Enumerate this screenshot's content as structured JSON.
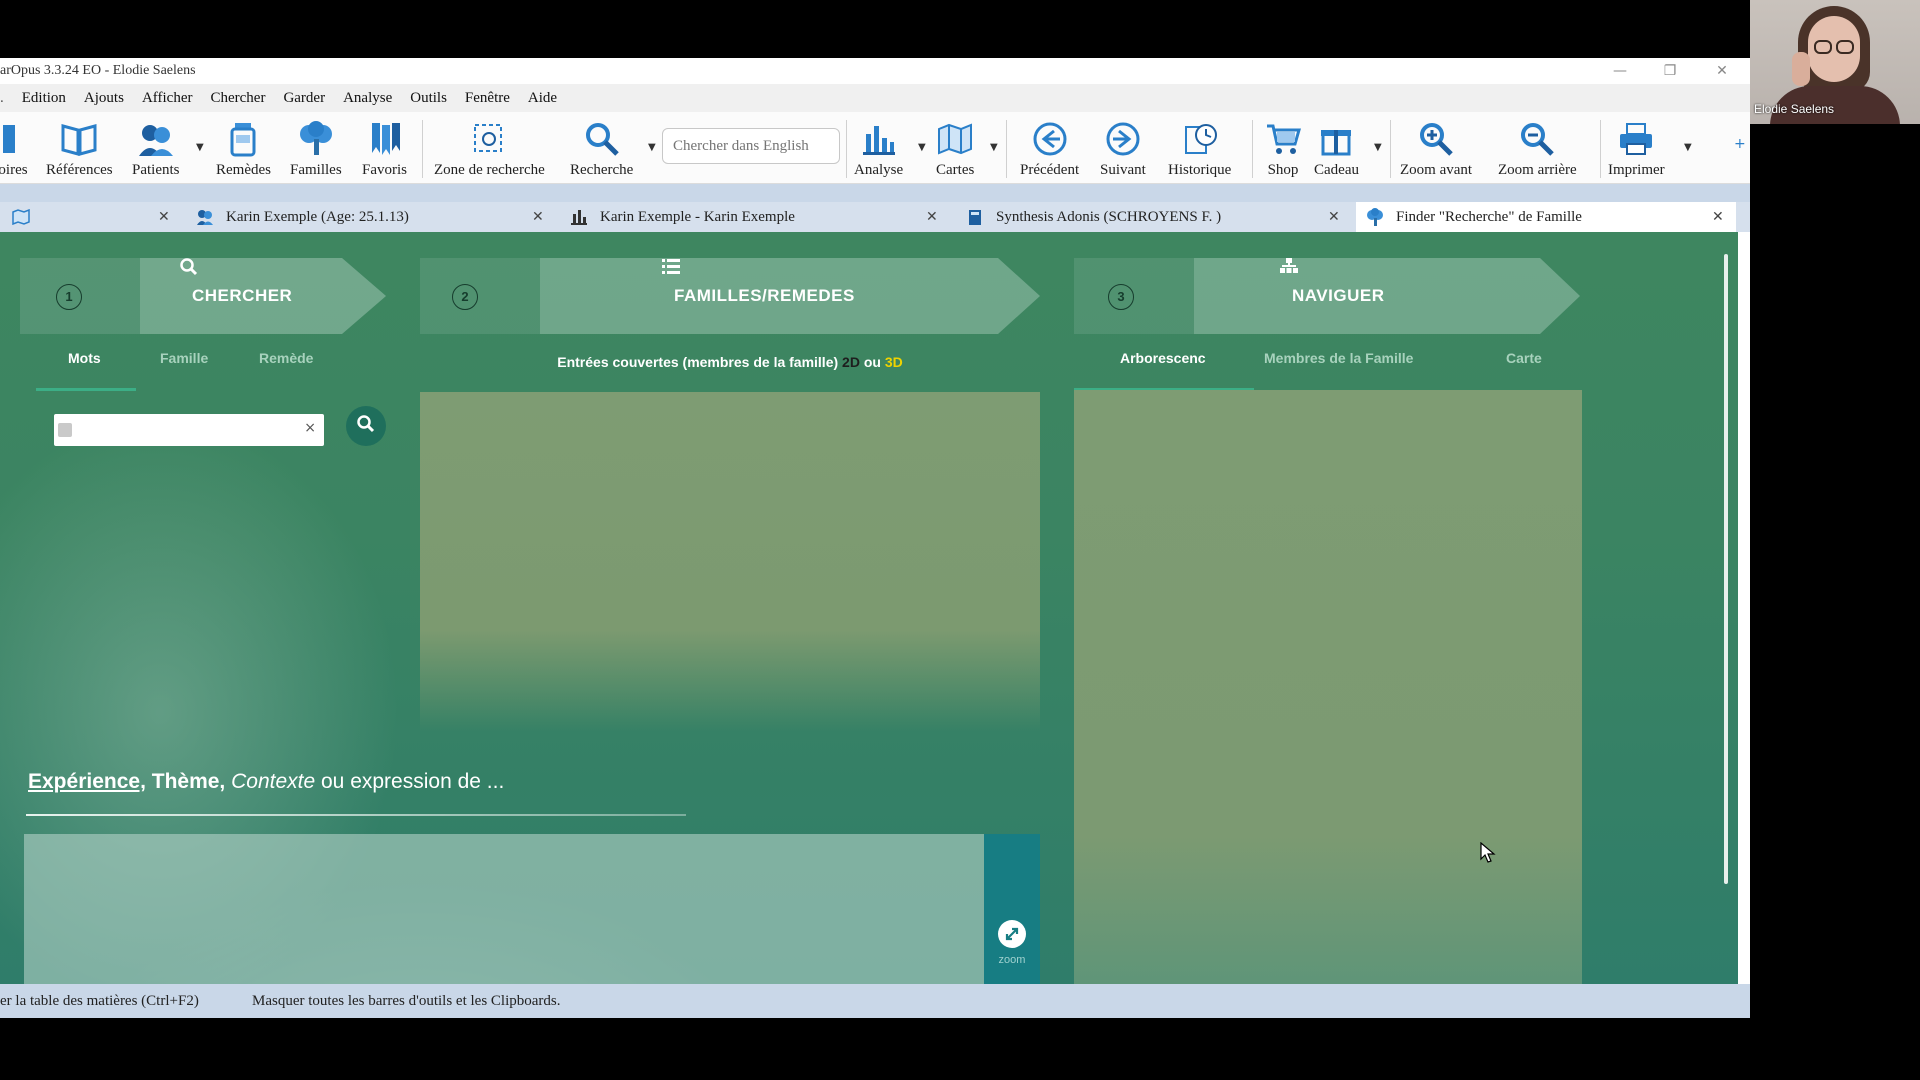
{
  "window": {
    "title": "arOpus 3.3.24  EO - Elodie Saelens"
  },
  "menu": [
    "Edition",
    "Ajouts",
    "Afficher",
    "Chercher",
    "Garder",
    "Analyse",
    "Outils",
    "Fenêtre",
    "Aide"
  ],
  "toolbar": {
    "items": [
      {
        "label": "oires",
        "icon": "book-icon"
      },
      {
        "label": "Références",
        "icon": "open-book-icon"
      },
      {
        "label": "Patients",
        "icon": "patients-icon"
      },
      {
        "label": "Remèdes",
        "icon": "remedy-jar-icon"
      },
      {
        "label": "Familles",
        "icon": "tree-icon"
      },
      {
        "label": "Favoris",
        "icon": "bookmarks-icon"
      },
      {
        "label": "Zone de recherche",
        "icon": "selection-icon"
      },
      {
        "label": "Recherche",
        "icon": "magnifier-icon"
      },
      {
        "label": "Analyse",
        "icon": "bar-chart-icon"
      },
      {
        "label": "Cartes",
        "icon": "map-icon"
      },
      {
        "label": "Précédent",
        "icon": "arrow-left-icon"
      },
      {
        "label": "Suivant",
        "icon": "arrow-right-icon"
      },
      {
        "label": "Historique",
        "icon": "history-icon"
      },
      {
        "label": "Shop",
        "icon": "cart-icon"
      },
      {
        "label": "Cadeau",
        "icon": "gift-icon"
      },
      {
        "label": "Zoom avant",
        "icon": "zoom-in-icon"
      },
      {
        "label": "Zoom arrière",
        "icon": "zoom-out-icon"
      },
      {
        "label": "Imprimer",
        "icon": "printer-icon"
      }
    ],
    "search_placeholder": "Chercher dans English"
  },
  "tabs": [
    {
      "label": "",
      "icon": "map-icon"
    },
    {
      "label": "Karin Exemple (Age: 25.1.13)",
      "icon": "patients-icon"
    },
    {
      "label": "Karin Exemple - Karin Exemple",
      "icon": "bar-chart-icon"
    },
    {
      "label": "Synthesis Adonis (SCHROYENS F. )",
      "icon": "book-icon"
    },
    {
      "label": "Finder \"Recherche\" de Famille",
      "icon": "tree-icon"
    }
  ],
  "finder": {
    "steps": [
      {
        "num": "1",
        "title": "CHERCHER",
        "icon": "search-icon"
      },
      {
        "num": "2",
        "title": "FAMILLES/REMEDES",
        "icon": "list-icon"
      },
      {
        "num": "3",
        "title": "NAVIGUER",
        "icon": "sitemap-icon"
      }
    ],
    "search_tabs": [
      "Mots",
      "Famille",
      "Remède"
    ],
    "families_hint": {
      "prefix": "Entrées couvertes (membres de la famille) ",
      "d2": "2D",
      "mid": " ou ",
      "d3": "3D"
    },
    "nav_tabs": [
      "Arborescenc",
      "Membres de la Famille",
      "Carte"
    ],
    "context": {
      "a": "Expérience,",
      "b": " Thème, ",
      "c": "Contexte",
      "d": " ou expression de ..."
    },
    "zoom_label": "zoom",
    "clear_glyph": "×"
  },
  "statusbar": {
    "left": "er la table des matières (Ctrl+F2)",
    "right": "Masquer toutes les barres d'outils et les Clipboards."
  },
  "webcam": {
    "name": "Elodie Saelens"
  },
  "colors": {
    "accent_green": "#3e8660",
    "panel": "#7e9c73",
    "zoom_strip": "#177d83"
  }
}
